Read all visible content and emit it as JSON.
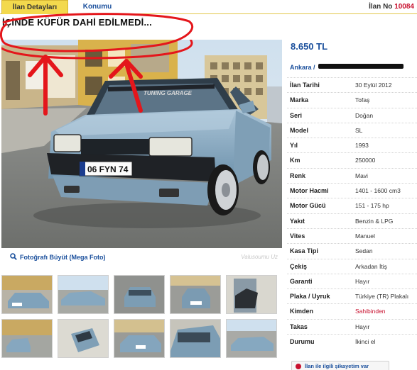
{
  "tabs": [
    {
      "label": "İlan Detayları",
      "active": true
    },
    {
      "label": "Konumu",
      "active": false
    }
  ],
  "ilan_no": {
    "label": "İlan No",
    "value": "10084"
  },
  "caption": "İÇİNDE KÜFÜR DAHİ EDİLMEDİ...",
  "photo": {
    "plate_text": "06 FYN 74",
    "windshield_text": "TUNING GARAGE",
    "enlarge_label": "Fotoğrafı Büyüt (Mega Foto)",
    "watermark_text": "Valusoumu Uz"
  },
  "price": "8.650 TL",
  "location": "Ankara /",
  "details": [
    {
      "key": "İlan Tarihi",
      "value": "30 Eylül 2012"
    },
    {
      "key": "Marka",
      "value": "Tofaş"
    },
    {
      "key": "Seri",
      "value": "Doğan"
    },
    {
      "key": "Model",
      "value": "SL"
    },
    {
      "key": "Yıl",
      "value": "1993"
    },
    {
      "key": "Km",
      "value": "250000"
    },
    {
      "key": "Renk",
      "value": "Mavi"
    },
    {
      "key": "Motor Hacmi",
      "value": "1401 - 1600 cm3"
    },
    {
      "key": "Motor Gücü",
      "value": "151 - 175 hp"
    },
    {
      "key": "Yakıt",
      "value": "Benzin & LPG"
    },
    {
      "key": "Vites",
      "value": "Manuel"
    },
    {
      "key": "Kasa Tipi",
      "value": "Sedan"
    },
    {
      "key": "Çekiş",
      "value": "Arkadan İtiş"
    },
    {
      "key": "Garanti",
      "value": "Hayır"
    },
    {
      "key": "Plaka / Uyruk",
      "value": "Türkiye (TR) Plakalı"
    },
    {
      "key": "Kimden",
      "value": "Sahibinden",
      "highlight": "#c8102e"
    },
    {
      "key": "Takas",
      "value": "Hayır"
    },
    {
      "key": "Durumu",
      "value": "İkinci el"
    }
  ],
  "complaint_button": "İlan ile ilgili şikayetim var",
  "colors": {
    "tab_active": "#f3d94d",
    "link_blue": "#1a4f9c",
    "accent_red": "#c8102e",
    "car_body": "#8fb2cc",
    "annotation_red": "#e4161b"
  }
}
